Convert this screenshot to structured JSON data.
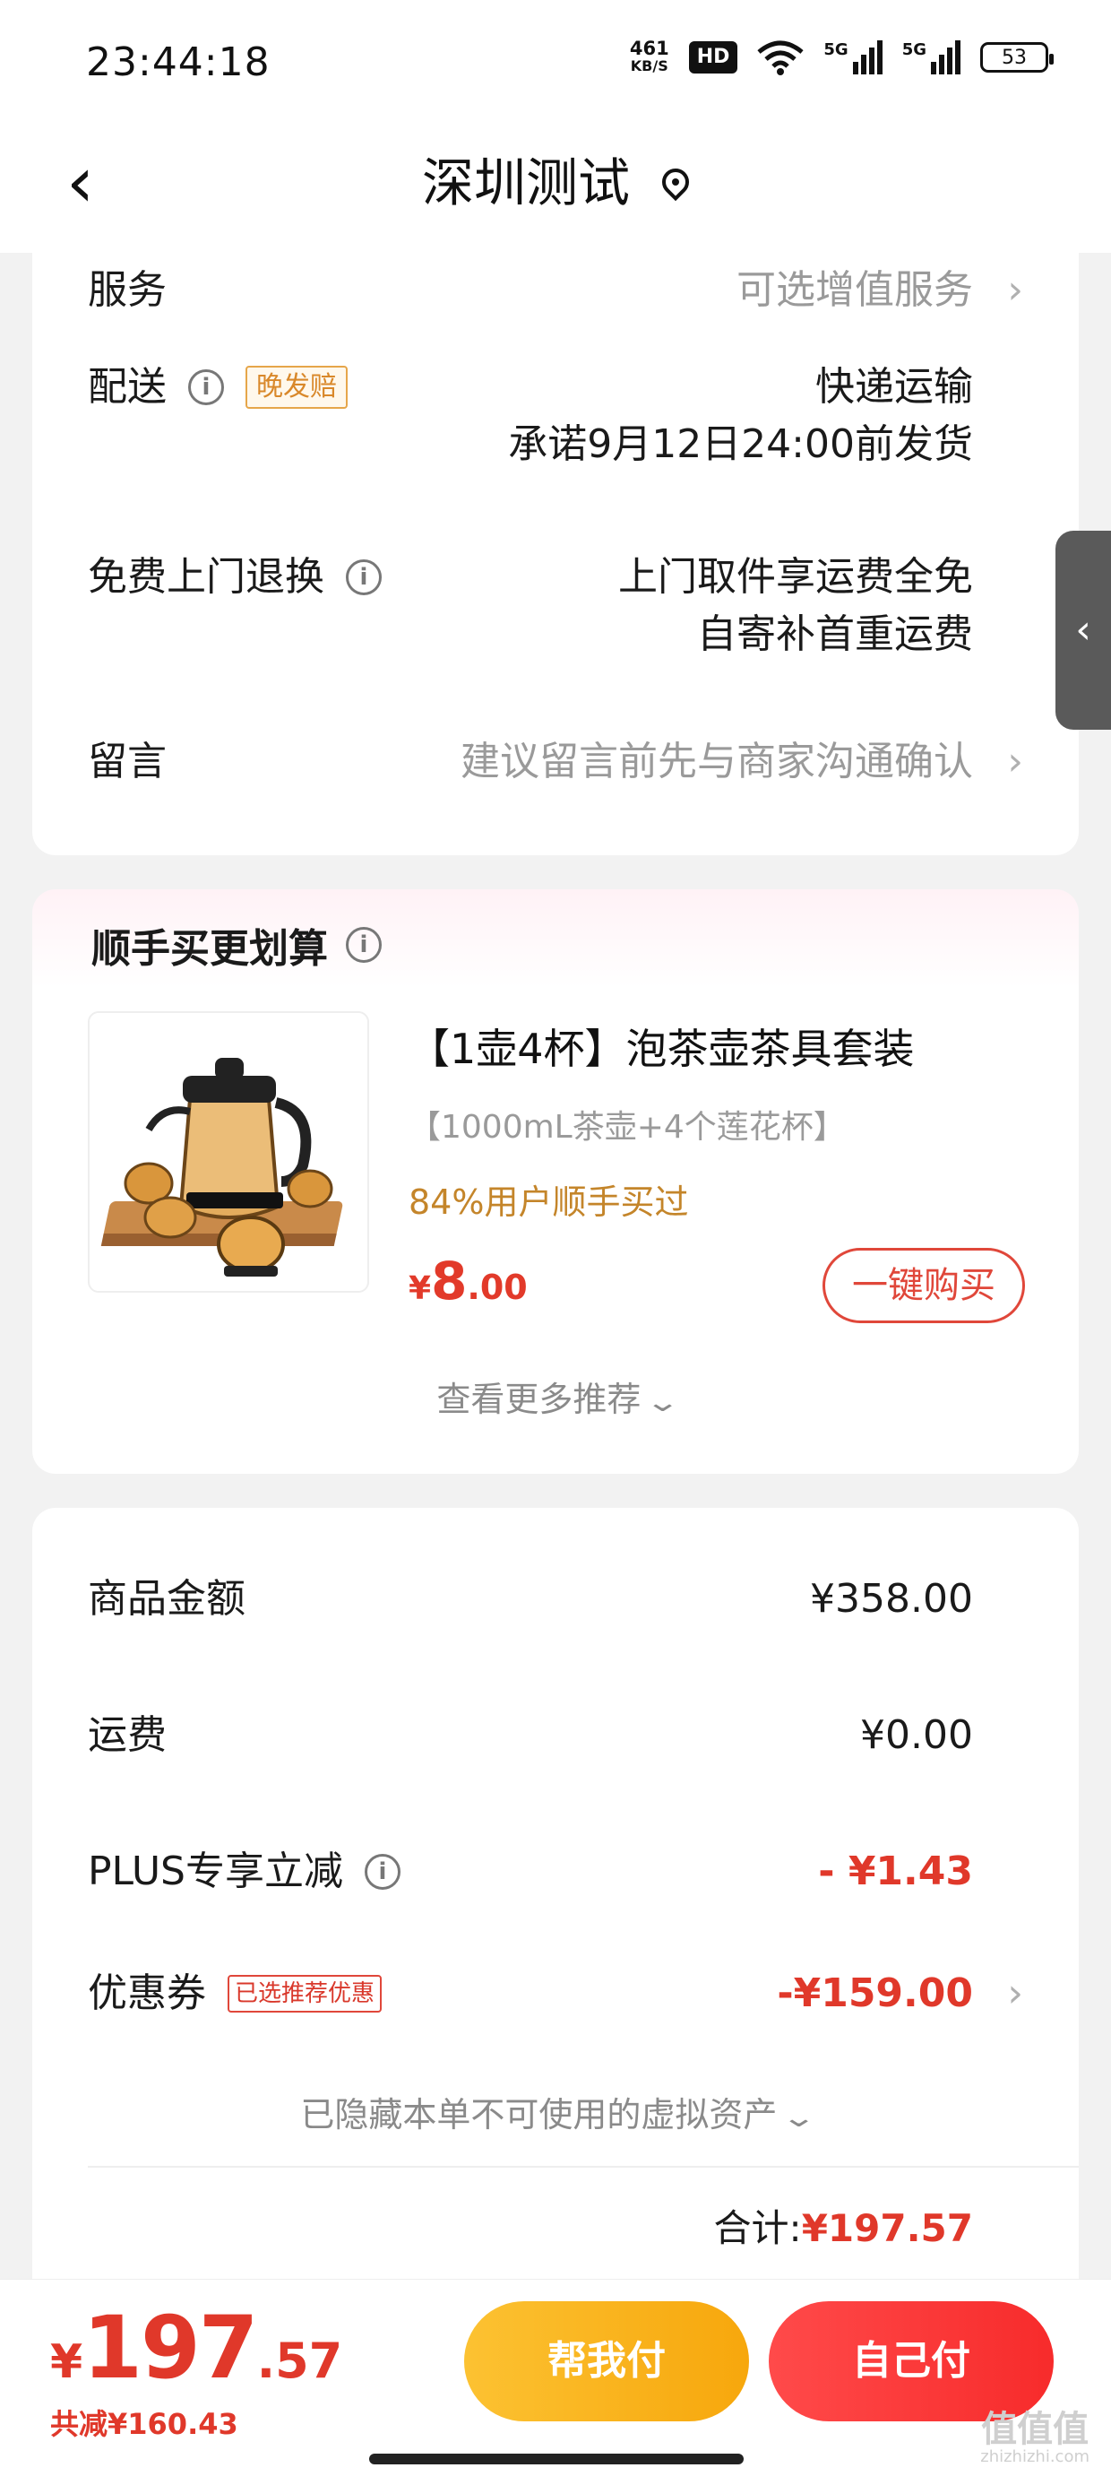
{
  "status_bar": {
    "time": "23:44:18",
    "net_speed_value": "461",
    "net_speed_unit": "KB/S",
    "hd_label": "HD",
    "signal1_label": "5G",
    "signal2_label": "5G",
    "battery": "53"
  },
  "header": {
    "title": "深圳测试"
  },
  "order_info": {
    "service_label": "服务",
    "service_value": "可选增值服务",
    "delivery_label": "配送",
    "delivery_tag": "晚发赔",
    "delivery_value1": "快递运输",
    "delivery_value2": "承诺9月12日24:00前发货",
    "return_label": "免费上门退换",
    "return_value1": "上门取件享运费全免",
    "return_value2": "自寄补首重运费",
    "message_label": "留言",
    "message_placeholder": "建议留言前先与商家沟通确认"
  },
  "recommend": {
    "title": "顺手买更划算",
    "product_name": "【1壶4杯】泡茶壶茶具套装",
    "product_spec": "【1000mL茶壶+4个莲花杯】",
    "bought_text": "84%用户顺手买过",
    "price_currency": "¥",
    "price_int": "8",
    "price_dec": ".00",
    "buy_button": "一键购买",
    "more_label": "查看更多推荐"
  },
  "totals": {
    "goods_label": "商品金额",
    "goods_value": "¥358.00",
    "shipping_label": "运费",
    "shipping_value": "¥0.00",
    "plus_label": "PLUS专享立减",
    "plus_value": "- ¥1.43",
    "coupon_label": "优惠券",
    "coupon_tag": "已选推荐优惠",
    "coupon_value": "-¥159.00",
    "hidden_assets": "已隐藏本单不可使用的虚拟资产",
    "sum_label": "合计:",
    "sum_value": "¥197.57"
  },
  "bottom_bar": {
    "total_currency": "¥",
    "total_int": "197",
    "total_dec": ".57",
    "saved_text": "共减¥160.43",
    "help_pay": "帮我付",
    "self_pay": "自己付"
  },
  "watermark": {
    "text": "值值值",
    "url": "zhizhizhi.com"
  },
  "colors": {
    "accent_red": "#e0382a",
    "accent_yellow": "#f7a70c",
    "bought_gold": "#c4852a"
  }
}
